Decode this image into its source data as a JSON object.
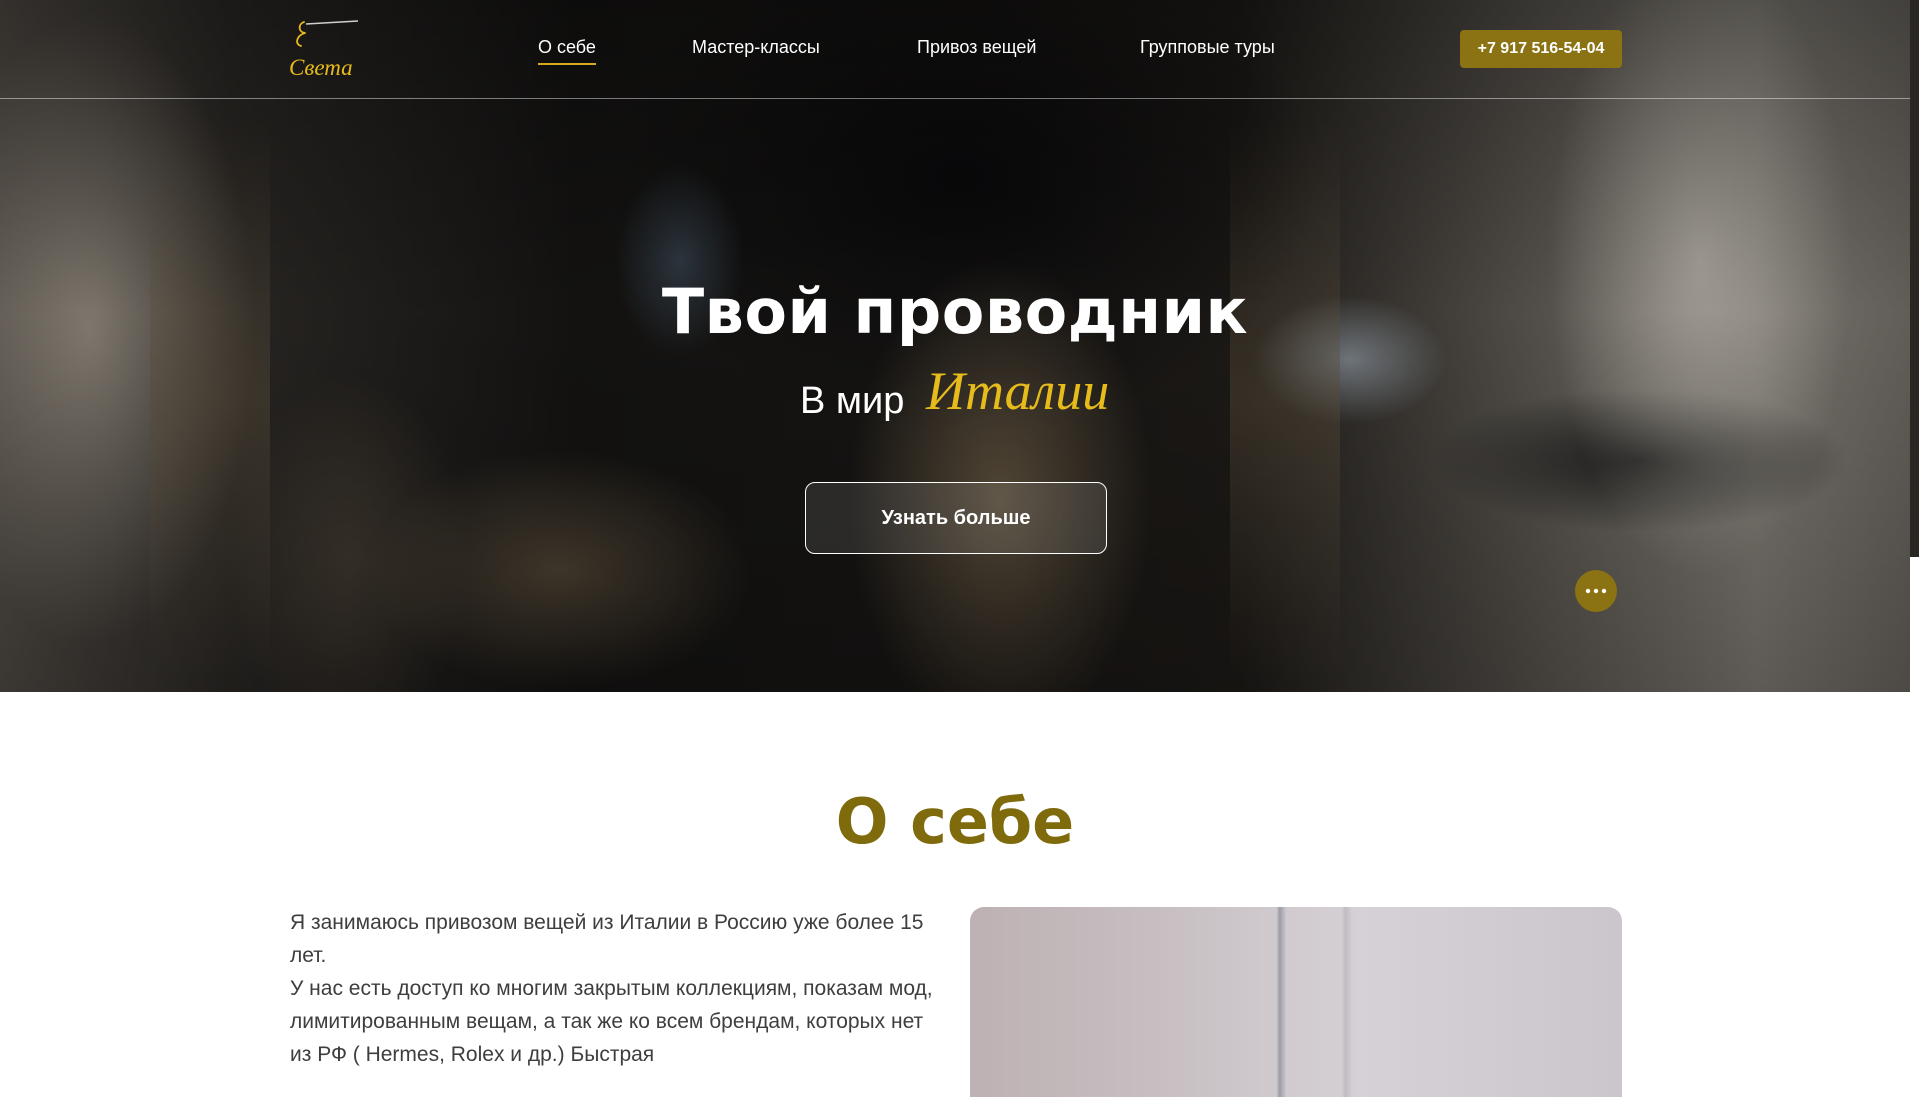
{
  "header": {
    "logo_text": "Света",
    "nav": [
      {
        "label": "О себе",
        "active": true
      },
      {
        "label": "Мастер-классы",
        "active": false
      },
      {
        "label": "Привоз вещей",
        "active": false
      },
      {
        "label": "Групповые туры",
        "active": false
      }
    ],
    "phone": "+7 917 516-54-04"
  },
  "hero": {
    "title": "Твой проводник",
    "subtitle": "В мир",
    "subtitle_script": "Италии",
    "cta_label": "Узнать больше",
    "chat_icon": "chat-dots-icon"
  },
  "about": {
    "title": "О себе",
    "paragraphs": [
      "Я занимаюсь привозом вещей из Италии в Россию уже более 15 лет.",
      "У нас есть доступ ко многим закрытым коллекциям, показам мод, лимитированным вещам, а так же ко всем брендам, которых нет из РФ ( Hermes, Rolex и др.) Быстрая"
    ]
  },
  "colors": {
    "accent": "#8b7212",
    "accent_gold": "#e8bb1c",
    "about_title": "#7f6a0c",
    "body_text": "#3e3e3e"
  }
}
